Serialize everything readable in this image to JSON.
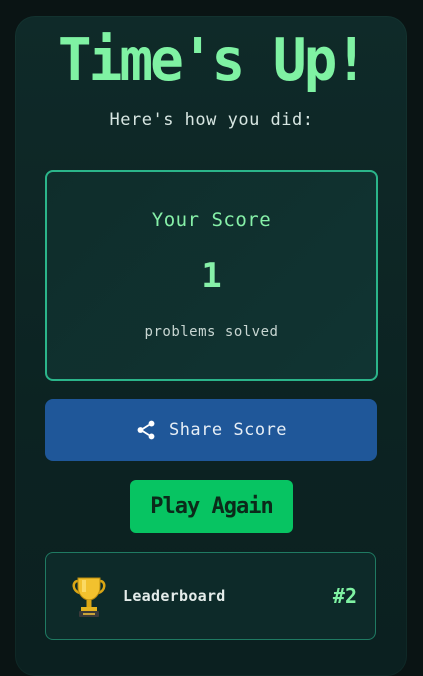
{
  "title": "Time's Up!",
  "subtitle": "Here's how you did:",
  "score": {
    "label": "Your Score",
    "value": "1",
    "caption": "problems solved"
  },
  "share": {
    "label": "Share Score",
    "icon": "share-icon"
  },
  "play_again": {
    "label": "Play Again"
  },
  "leaderboard": {
    "label": "Leaderboard",
    "rank": "#2",
    "icon": "trophy-icon"
  },
  "colors": {
    "accent_green": "#7ff2a3",
    "share_blue": "#1f5799",
    "play_green": "#07c462",
    "panel_bg": "#0f2a29"
  }
}
